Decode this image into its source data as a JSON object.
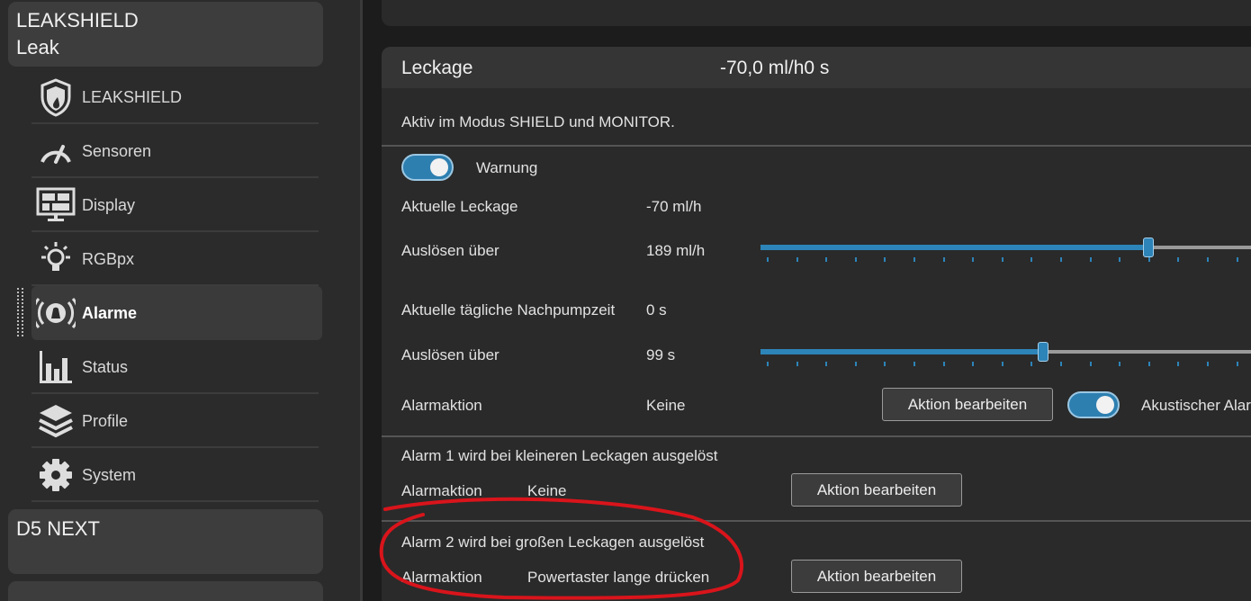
{
  "sidebar": {
    "device1": {
      "line1": "LEAKSHIELD",
      "line2": "Leak"
    },
    "items": [
      {
        "label": "LEAKSHIELD",
        "icon": "shield-drop-icon"
      },
      {
        "label": "Sensoren",
        "icon": "gauge-icon"
      },
      {
        "label": "Display",
        "icon": "display-icon"
      },
      {
        "label": "RGBpx",
        "icon": "lightbulb-icon"
      },
      {
        "label": "Alarme",
        "icon": "alarm-bell-icon",
        "active": true
      },
      {
        "label": "Status",
        "icon": "bar-chart-icon"
      },
      {
        "label": "Profile",
        "icon": "layers-icon"
      },
      {
        "label": "System",
        "icon": "gear-icon"
      }
    ],
    "device2": {
      "line1": "D5 NEXT"
    }
  },
  "leak_panel": {
    "title": "Leckage",
    "header_value": "-70,0 ml/h0 s",
    "description": "Aktiv im Modus SHIELD und MONITOR.",
    "warning": {
      "label": "Warnung",
      "enabled": true
    },
    "current_leak": {
      "label": "Aktuelle Leckage",
      "value": "-70 ml/h"
    },
    "trigger_leak": {
      "label": "Auslösen über",
      "value": "189 ml/h",
      "slider_fraction": 0.77
    },
    "current_pump": {
      "label": "Aktuelle tägliche Nachpumpzeit",
      "value": "0 s"
    },
    "trigger_pump": {
      "label": "Auslösen über",
      "value": "99 s",
      "slider_fraction": 0.56
    },
    "alarm_action": {
      "label": "Alarmaktion",
      "value": "Keine",
      "button": "Aktion bearbeiten",
      "acoustic_label": "Akustischer Alarm",
      "acoustic_enabled": true
    },
    "alarm1": {
      "title": "Alarm 1 wird bei kleineren Leckagen ausgelöst",
      "action_label": "Alarmaktion",
      "action_value": "Keine",
      "button": "Aktion bearbeiten"
    },
    "alarm2": {
      "title": "Alarm 2 wird bei großen Leckagen ausgelöst",
      "action_label": "Alarmaktion",
      "action_value": "Powertaster lange drücken",
      "button": "Aktion bearbeiten"
    }
  },
  "colors": {
    "accent": "#2d84b8",
    "annotation": "#d9141b"
  }
}
